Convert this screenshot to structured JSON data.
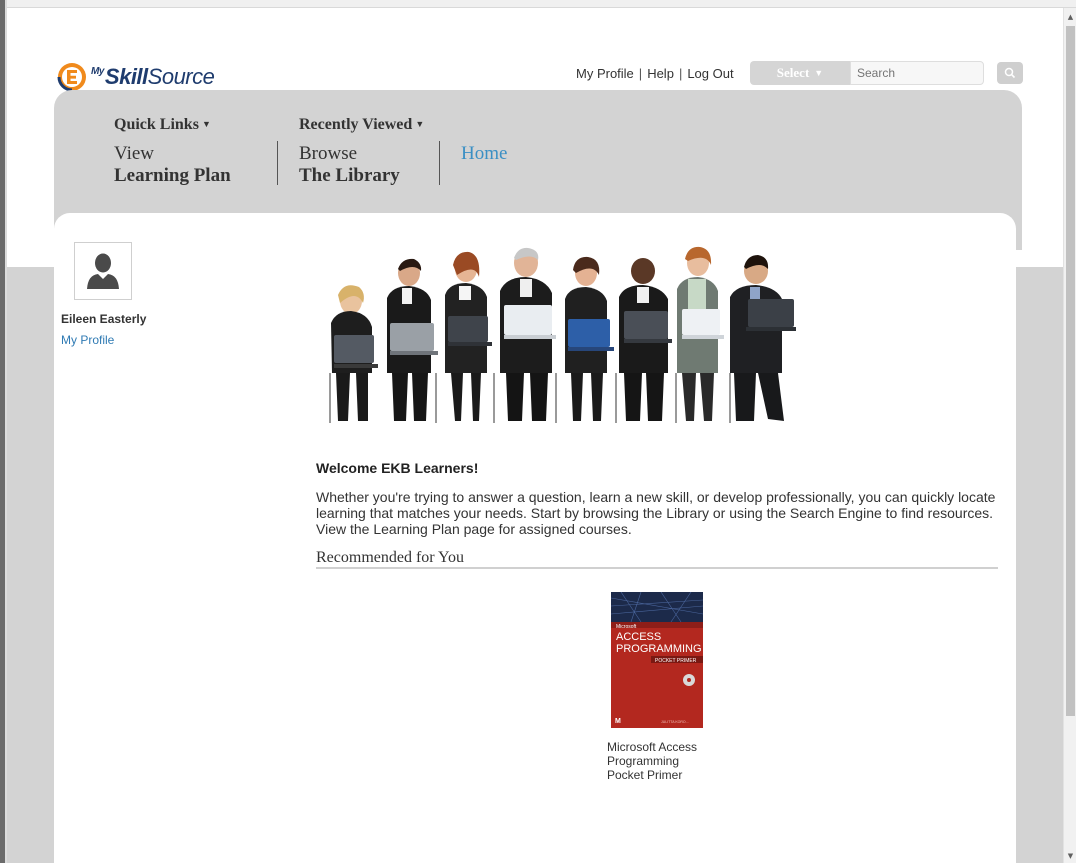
{
  "header": {
    "logo_my": "My",
    "logo_skill": "Skill",
    "logo_source": "Source",
    "links": [
      "My Profile",
      "Help",
      "Log Out"
    ],
    "select_label": "Select",
    "search_placeholder": "Search"
  },
  "nav": {
    "quick_links": "Quick Links",
    "recently_viewed": "Recently Viewed",
    "items": [
      {
        "line1": "View",
        "line2": "Learning Plan"
      },
      {
        "line1": "Browse",
        "line2": "The Library"
      }
    ],
    "home": "Home"
  },
  "user": {
    "name": "Eileen Easterly",
    "profile_link": "My Profile"
  },
  "main": {
    "welcome_title": "Welcome EKB Learners!",
    "welcome_text": "Whether you're trying to answer a question, learn a new skill, or develop professionally, you can quickly locate learning that matches your needs. Start by browsing the Library or using the Search Engine to find resources. View the Learning Plan page for assigned courses.",
    "recommended_title": "Recommended for You",
    "recommended": [
      {
        "title": "Microsoft Access Programming Pocket Primer",
        "cover_brand": "Microsoft",
        "cover_line1": "ACCESS",
        "cover_line2": "PROGRAMMING",
        "cover_line3": "POCKET PRIMER",
        "cover_author": "JULITTA KORO..."
      }
    ]
  },
  "colors": {
    "brand_orange": "#f08a1c",
    "brand_navy": "#1f3c6e",
    "link_blue": "#2f7ab3",
    "home_blue": "#3a8fc4",
    "panel_gray": "#d3d3d3"
  }
}
